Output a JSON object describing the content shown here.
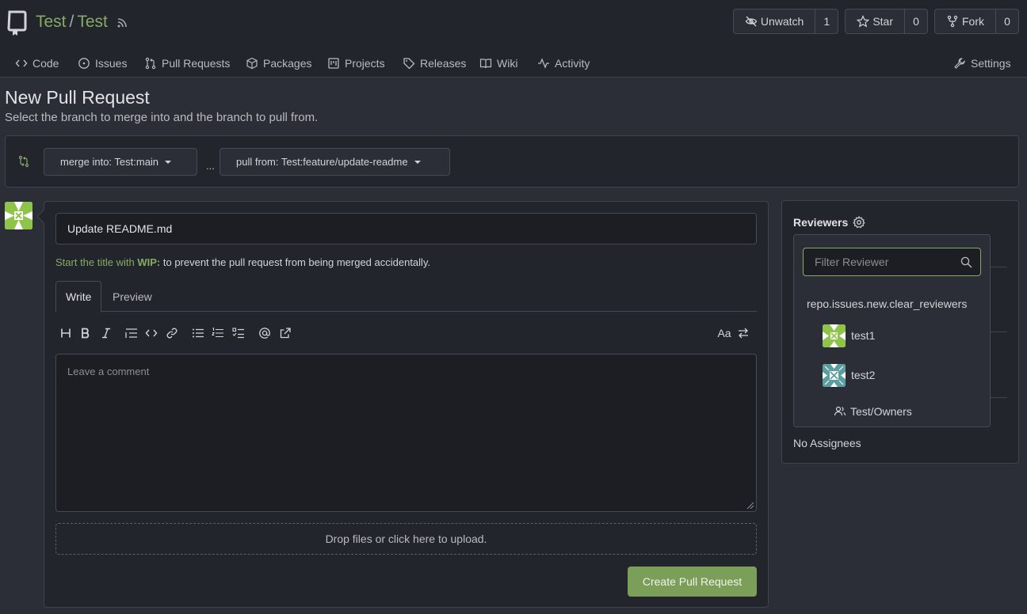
{
  "repo": {
    "owner": "Test",
    "separator": "/",
    "name": "Test"
  },
  "repo_buttons": [
    {
      "label": "Unwatch",
      "count": "1",
      "icon": "eye-closed-icon"
    },
    {
      "label": "Star",
      "count": "0",
      "icon": "star-icon"
    },
    {
      "label": "Fork",
      "count": "0",
      "icon": "fork-icon"
    }
  ],
  "tabs": [
    {
      "label": "Code",
      "icon": "code-icon"
    },
    {
      "label": "Issues",
      "icon": "issue-icon"
    },
    {
      "label": "Pull Requests",
      "icon": "pull-request-icon"
    },
    {
      "label": "Packages",
      "icon": "package-icon"
    },
    {
      "label": "Projects",
      "icon": "project-icon"
    },
    {
      "label": "Releases",
      "icon": "tag-icon"
    },
    {
      "label": "Wiki",
      "icon": "book-icon"
    },
    {
      "label": "Activity",
      "icon": "pulse-icon"
    },
    {
      "label": "Settings",
      "icon": "tool-icon"
    }
  ],
  "page": {
    "title": "New Pull Request",
    "subtitle": "Select the branch to merge into and the branch to pull from."
  },
  "branches": {
    "merge_into": "merge into: Test:main",
    "separator": "...",
    "pull_from": "pull from: Test:feature/update-readme"
  },
  "form": {
    "title_value": "Update README.md",
    "wip_hint_prefix": "Start the title with",
    "wip_keyword": "WIP:",
    "wip_hint_suffix": "to prevent the pull request from being merged accidentally.",
    "tab_write": "Write",
    "tab_preview": "Preview",
    "comment_placeholder": "Leave a comment",
    "dropzone": "Drop files or click here to upload.",
    "submit": "Create Pull Request",
    "toolbar_font_toggle": "Aa"
  },
  "sidebar": {
    "reviewers_label": "Reviewers",
    "no_assignees": "No Assignees"
  },
  "reviewer_popup": {
    "filter_placeholder": "Filter Reviewer",
    "clear_label": "repo.issues.new.clear_reviewers",
    "reviewers": [
      {
        "name": "test1"
      },
      {
        "name": "test2"
      }
    ],
    "team": "Test/Owners"
  },
  "colors": {
    "accent": "#87ab63",
    "button_primary": "#7b9f58",
    "background": "#2b2e36",
    "panel": "#22252c"
  }
}
